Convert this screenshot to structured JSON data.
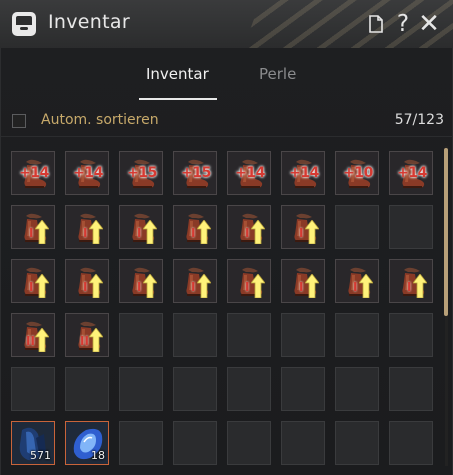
{
  "window": {
    "title": "Inventar",
    "icons": [
      "inventory-icon",
      "document-icon",
      "help-icon",
      "close-icon"
    ]
  },
  "tabs": [
    {
      "label": "Inventar",
      "active": true
    },
    {
      "label": "Perle",
      "active": false
    }
  ],
  "sort": {
    "label": "Autom. sortieren",
    "checked": false
  },
  "capacity": "57/123",
  "colors": {
    "accent_gold": "#c7a96a",
    "enhance_red": "#d63a32",
    "scroll_thumb": "#b8a079"
  },
  "slots": [
    {
      "kind": "boot",
      "enh": "+14"
    },
    {
      "kind": "boot",
      "enh": "+14"
    },
    {
      "kind": "boot",
      "enh": "+15"
    },
    {
      "kind": "boot",
      "enh": "+15"
    },
    {
      "kind": "boot",
      "enh": "+14"
    },
    {
      "kind": "boot",
      "enh": "+14"
    },
    {
      "kind": "boot",
      "enh": "+10"
    },
    {
      "kind": "boot",
      "enh": "+14"
    },
    {
      "kind": "boot",
      "pip": "I",
      "arrow": true
    },
    {
      "kind": "boot",
      "pip": "I",
      "arrow": true
    },
    {
      "kind": "boot",
      "pip": "I",
      "arrow": true
    },
    {
      "kind": "boot",
      "pip": "I",
      "arrow": true
    },
    {
      "kind": "boot",
      "pip": "I",
      "arrow": true
    },
    {
      "kind": "boot",
      "pip": "I",
      "arrow": true
    },
    {
      "kind": "empty"
    },
    {
      "kind": "empty"
    },
    {
      "kind": "boot",
      "pip": "I",
      "arrow": true
    },
    {
      "kind": "boot",
      "pip": "I",
      "arrow": true
    },
    {
      "kind": "boot",
      "pip": "I",
      "arrow": true
    },
    {
      "kind": "boot",
      "pip": "I",
      "arrow": true
    },
    {
      "kind": "boot",
      "pip": "I",
      "arrow": true
    },
    {
      "kind": "boot",
      "pip": "I",
      "arrow": true
    },
    {
      "kind": "boot",
      "pip": "I",
      "arrow": true
    },
    {
      "kind": "boot",
      "pip": "I",
      "arrow": true
    },
    {
      "kind": "boot",
      "pip": "II",
      "arrow": true
    },
    {
      "kind": "boot",
      "pip": "II",
      "arrow": true
    },
    {
      "kind": "empty"
    },
    {
      "kind": "empty"
    },
    {
      "kind": "empty"
    },
    {
      "kind": "empty"
    },
    {
      "kind": "empty"
    },
    {
      "kind": "empty"
    },
    {
      "kind": "empty"
    },
    {
      "kind": "empty"
    },
    {
      "kind": "empty"
    },
    {
      "kind": "empty"
    },
    {
      "kind": "empty"
    },
    {
      "kind": "empty"
    },
    {
      "kind": "empty"
    },
    {
      "kind": "empty"
    },
    {
      "kind": "stone",
      "qty": "571"
    },
    {
      "kind": "gem",
      "qty": "18"
    },
    {
      "kind": "empty"
    },
    {
      "kind": "empty"
    },
    {
      "kind": "empty"
    },
    {
      "kind": "empty"
    },
    {
      "kind": "empty"
    },
    {
      "kind": "empty"
    }
  ]
}
